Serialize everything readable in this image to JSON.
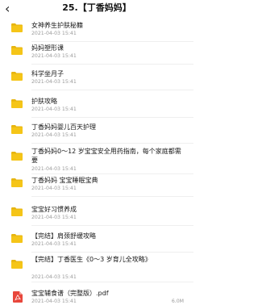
{
  "header": {
    "title": "25.【丁香妈妈】",
    "back_icon": "chevron-left-icon"
  },
  "colors": {
    "folder": "#f5c518",
    "folder_tab": "#e7b510",
    "pdf": "#e8473c"
  },
  "items": [
    {
      "name": "女神养生护肤秘籍",
      "date": "2021-04-03 15:41",
      "type": "folder"
    },
    {
      "name": "妈妈塑形课",
      "date": "2021-04-03 15:41",
      "type": "folder"
    },
    {
      "name": "科学坐月子",
      "date": "2021-04-03 15:41",
      "type": "folder"
    },
    {
      "name": "护肤攻略",
      "date": "2021-04-03 15:41",
      "type": "folder"
    },
    {
      "name": "丁香妈妈婴儿百天护理",
      "date": "2021-04-03 15:41",
      "type": "folder"
    },
    {
      "name": "丁香妈妈0～12 岁宝宝安全用药指南，每个家庭都需要",
      "date": "2021-04-03 15:41",
      "type": "folder"
    },
    {
      "name": "丁香妈妈 宝宝睡眠宝典",
      "date": "2021-04-03 15:41",
      "type": "folder"
    },
    {
      "name": "宝宝好习惯养成",
      "date": "2021-04-03 15:41",
      "type": "folder"
    },
    {
      "name": "【完结】肩颈舒缓攻略",
      "date": "2021-04-03 15:41",
      "type": "folder"
    },
    {
      "name": "【完结】丁香医生《0～3 岁育儿全攻略》",
      "date": "2021-04-03 15:41",
      "type": "folder"
    },
    {
      "name": "宝宝辅食谱（完整版）.pdf",
      "date": "2021-04-03 15:41",
      "type": "pdf",
      "size": "6.0M"
    }
  ]
}
